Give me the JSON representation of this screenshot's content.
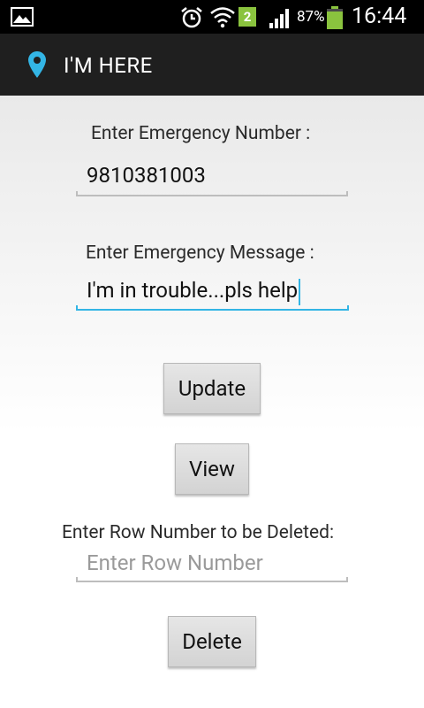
{
  "status_bar": {
    "notification_badge": "2",
    "battery_percent": "87%",
    "time": "16:44",
    "icons": [
      "gallery-icon",
      "alarm-icon",
      "wifi-icon",
      "signal-icon",
      "battery-icon"
    ]
  },
  "action_bar": {
    "icon": "location-pin-icon",
    "title": "I'M HERE",
    "accent_color": "#33b5e5"
  },
  "form": {
    "number_label": "Enter Emergency Number :",
    "number_value": "9810381003",
    "message_label": "Enter Emergency Message :",
    "message_value": "I'm in trouble...pls help",
    "update_label": "Update",
    "view_label": "View",
    "row_label": "Enter Row Number to be Deleted:",
    "row_placeholder": "Enter Row Number",
    "delete_label": "Delete"
  }
}
